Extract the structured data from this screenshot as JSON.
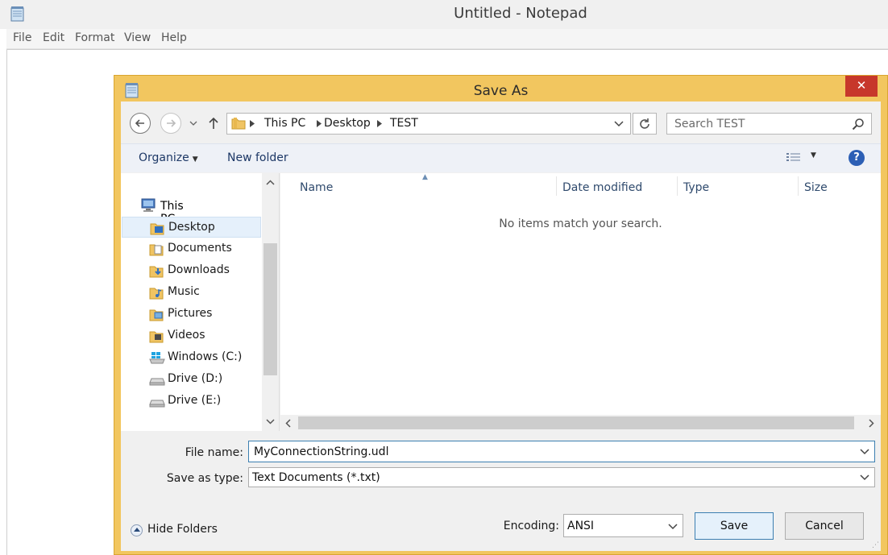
{
  "notepad": {
    "title": "Untitled - Notepad",
    "menu": [
      "File",
      "Edit",
      "Format",
      "View",
      "Help"
    ]
  },
  "dialog": {
    "title": "Save As",
    "close_label": "✕",
    "address": {
      "crumbs": [
        "This PC",
        "Desktop",
        "TEST"
      ]
    },
    "search_placeholder": "Search TEST",
    "toolbar": {
      "organize": "Organize",
      "new_folder": "New folder",
      "help": "?"
    },
    "nav": {
      "root": "This PC",
      "items": [
        {
          "label": "Desktop",
          "icon": "desktop-folder-icon",
          "selected": true
        },
        {
          "label": "Documents",
          "icon": "documents-folder-icon"
        },
        {
          "label": "Downloads",
          "icon": "downloads-folder-icon"
        },
        {
          "label": "Music",
          "icon": "music-folder-icon"
        },
        {
          "label": "Pictures",
          "icon": "pictures-folder-icon"
        },
        {
          "label": "Videos",
          "icon": "videos-folder-icon"
        },
        {
          "label": "Windows (C:)",
          "icon": "windows-drive-icon"
        },
        {
          "label": "Drive (D:)",
          "icon": "drive-icon"
        },
        {
          "label": "Drive (E:)",
          "icon": "drive-icon"
        }
      ]
    },
    "columns": [
      "Name",
      "Date modified",
      "Type",
      "Size"
    ],
    "empty_message": "No items match your search.",
    "file_name_label": "File name:",
    "file_name_value": "MyConnectionString.udl",
    "save_type_label": "Save as type:",
    "save_type_value": "Text Documents (*.txt)",
    "hide_folders": "Hide Folders",
    "encoding_label": "Encoding:",
    "encoding_value": "ANSI",
    "save_button": "Save",
    "cancel_button": "Cancel"
  },
  "colors": {
    "dialog_frame": "#f2c65f",
    "close_button": "#c7372b",
    "help_icon": "#2c5fb5",
    "selected_item": "#e5f0fb"
  }
}
